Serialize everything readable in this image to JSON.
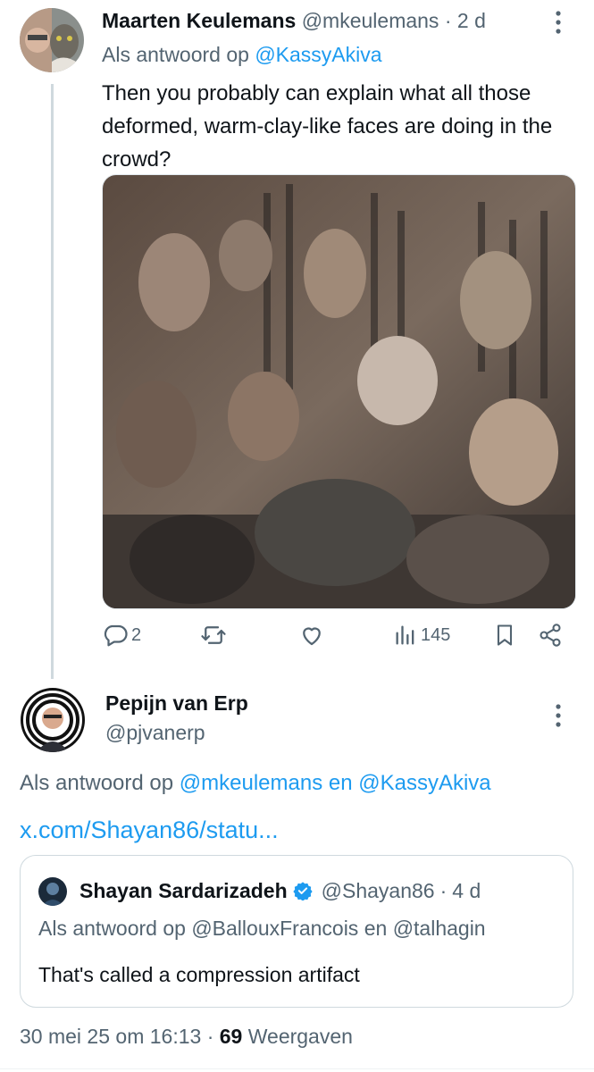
{
  "tweet1": {
    "author_name": "Maarten Keulemans",
    "handle": "@mkeulemans",
    "separator": "·",
    "time": "2 d",
    "replying_prefix": "Als antwoord op",
    "replying_to": "@KassyAkiva",
    "text": "Then you probably can explain what all those deformed, warm-clay-like faces are doing in the crowd?",
    "actions": {
      "reply_icon": "reply-icon",
      "reply_count": "2",
      "retweet_icon": "retweet-icon",
      "like_icon": "heart-icon",
      "views_icon": "views-icon",
      "views_count": "145",
      "bookmark_icon": "bookmark-icon",
      "share_icon": "share-icon"
    }
  },
  "tweet2": {
    "author_name": "Pepijn van Erp",
    "handle": "@pjvanerp",
    "replying_prefix": "Als antwoord op",
    "replying_to_1": "@mkeulemans",
    "replying_conjunction": "en",
    "replying_to_2": "@KassyAkiva",
    "link_text": "x.com/Shayan86/statu...",
    "quote": {
      "author_name": "Shayan Sardarizadeh",
      "handle": "@Shayan86",
      "separator": "·",
      "time": "4 d",
      "replying_prefix": "Als antwoord op",
      "replying_to_1": "@BallouxFrancois",
      "replying_conjunction": "en",
      "replying_to_2": "@talhagin",
      "text": "That's called a compression artifact"
    },
    "timestamp": "30 mei 25 om 16:13",
    "separator": "·",
    "views_count": "69",
    "views_label": "Weergaven"
  },
  "colors": {
    "accent": "#1d9bf0",
    "text": "#0f1419",
    "secondary": "#536471",
    "border": "#cfd9de"
  }
}
